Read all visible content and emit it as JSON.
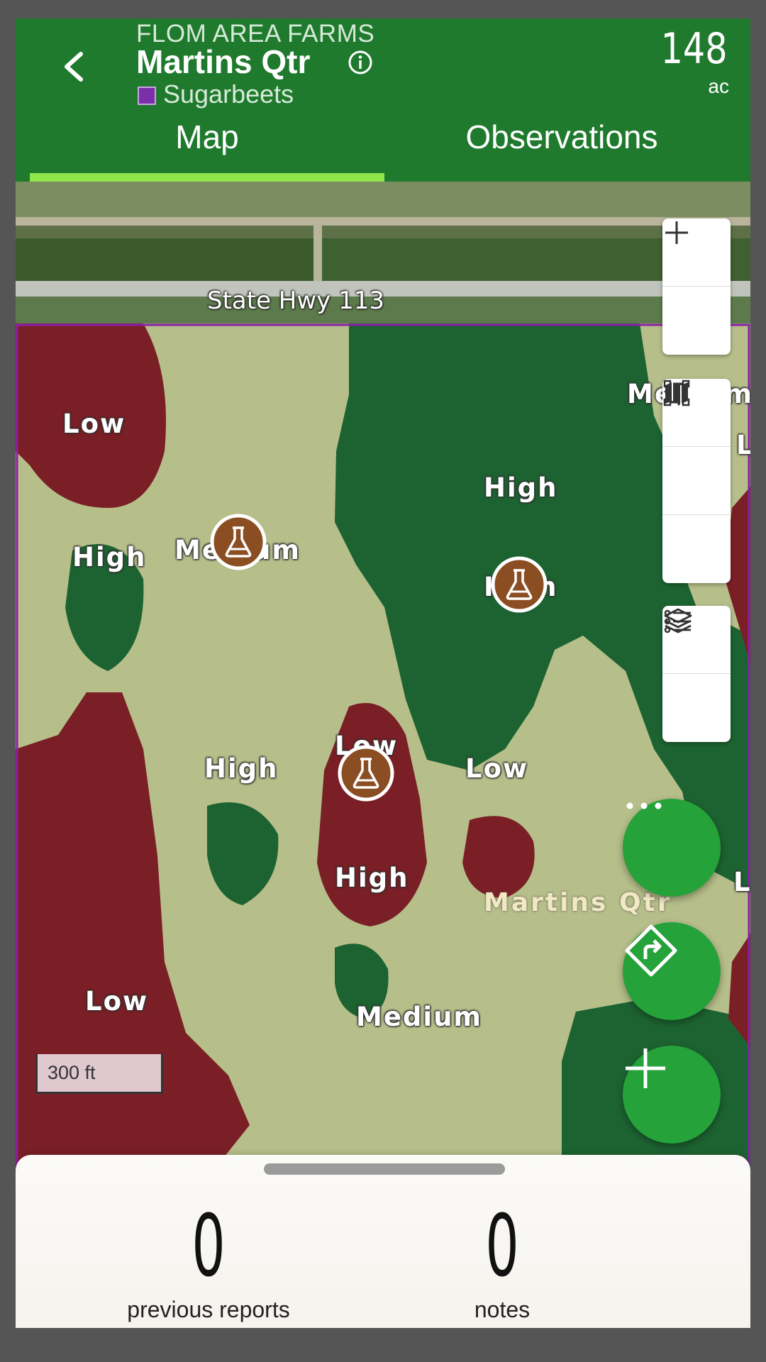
{
  "header": {
    "farm_name": "FLOM AREA FARMS",
    "field_name": "Martins Qtr",
    "crop": "Sugarbeets",
    "crop_color": "#7b2fa8",
    "acreage": "148",
    "acreage_unit": "ac",
    "back_icon": "chevron-left-icon",
    "info_icon": "info-icon"
  },
  "tabs": [
    {
      "label": "Map",
      "active": true
    },
    {
      "label": "Observations",
      "active": false
    }
  ],
  "map": {
    "road_label": "State Hwy 113",
    "field_label": "Martins Qtr",
    "zone_colors": {
      "low": "#7a1f26",
      "medium": "#b6be8a",
      "high": "#1d6331"
    },
    "zone_labels": [
      "Low",
      "High",
      "Medium",
      "High",
      "High",
      "Low",
      "High",
      "Low",
      "High",
      "Low",
      "Medium",
      "Medium",
      "Low",
      "Low"
    ],
    "scale_label": "300 ft",
    "controls": {
      "zoom": [
        "zoom-in-icon",
        "zoom-out-icon"
      ],
      "navigation": [
        "locate-arrow-icon",
        "draw-shape-icon",
        "map-icon"
      ],
      "layers": [
        "layers-icon",
        "legend-list-icon"
      ]
    },
    "fabs": [
      "more-options-icon",
      "directions-icon",
      "add-icon"
    ]
  },
  "bottom_sheet": {
    "previous_reports_count": "0",
    "previous_reports_label": "previous reports",
    "notes_count": "0",
    "notes_label": "notes"
  }
}
